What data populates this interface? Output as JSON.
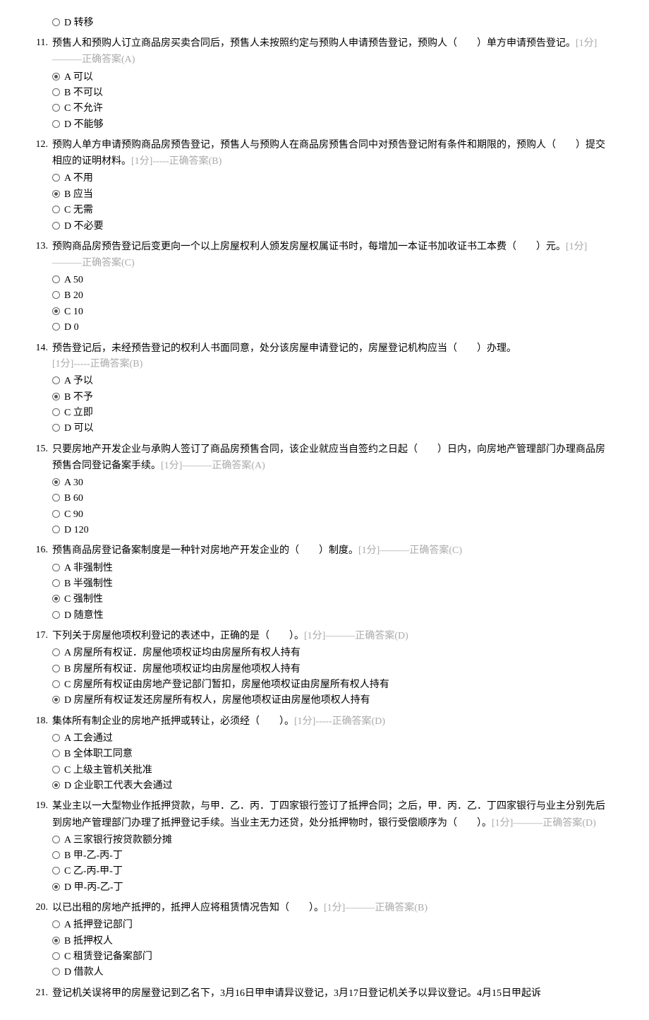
{
  "questions": [
    {
      "num": "",
      "text": "",
      "meta": "",
      "options": [
        {
          "label": "D 转移",
          "selected": false
        }
      ]
    },
    {
      "num": "11.",
      "text": "预售人和预购人订立商品房买卖合同后，预售人未按照约定与预购人申请预告登记，预购人（　　）单方申请预告登记。",
      "meta": "[1分]———正确答案(A)",
      "options": [
        {
          "label": "A 可以",
          "selected": true
        },
        {
          "label": "B 不可以",
          "selected": false
        },
        {
          "label": "C 不允许",
          "selected": false
        },
        {
          "label": "D 不能够",
          "selected": false
        }
      ]
    },
    {
      "num": "12.",
      "text": "预购人单方申请预购商品房预告登记，预售人与预购人在商品房预售合同中对预告登记附有条件和期限的，预购人（　　）提交相应的证明材料。",
      "meta": "[1分]-----正确答案(B)",
      "options": [
        {
          "label": "A 不用",
          "selected": false
        },
        {
          "label": "B 应当",
          "selected": true
        },
        {
          "label": "C 无需",
          "selected": false
        },
        {
          "label": "D 不必要",
          "selected": false
        }
      ]
    },
    {
      "num": "13.",
      "text": "预购商品房预告登记后变更向一个以上房屋权利人颁发房屋权属证书时，每增加一本证书加收证书工本费（　　）元。",
      "meta": "[1分]———正确答案(C)",
      "options": [
        {
          "label": "A 50",
          "selected": false
        },
        {
          "label": "B 20",
          "selected": false
        },
        {
          "label": "C 10",
          "selected": true
        },
        {
          "label": "D 0",
          "selected": false
        }
      ]
    },
    {
      "num": "14.",
      "text": "预告登记后，未经预告登记的权利人书面同意，处分该房屋申请登记的，房屋登记机构应当（　　）办理。",
      "meta": "[1分]-----正确答案(B)",
      "newlineMeta": true,
      "options": [
        {
          "label": "A 予以",
          "selected": false
        },
        {
          "label": "B 不予",
          "selected": true
        },
        {
          "label": "C 立即",
          "selected": false
        },
        {
          "label": "D 可以",
          "selected": false
        }
      ]
    },
    {
      "num": "15.",
      "text": "只要房地产开发企业与承购人签订了商品房预售合同，该企业就应当自签约之日起（　　）日内，向房地产管理部门办理商品房预售合同登记备案手续。",
      "meta": "[1分]———正确答案(A)",
      "options": [
        {
          "label": "A 30",
          "selected": true
        },
        {
          "label": "B 60",
          "selected": false
        },
        {
          "label": "C 90",
          "selected": false
        },
        {
          "label": "D 120",
          "selected": false
        }
      ]
    },
    {
      "num": "16.",
      "text": "预售商品房登记备案制度是一种针对房地产开发企业的（　　）制度。",
      "meta": "[1分]———正确答案(C)",
      "options": [
        {
          "label": "A 非强制性",
          "selected": false
        },
        {
          "label": "B 半强制性",
          "selected": false
        },
        {
          "label": "C 强制性",
          "selected": true
        },
        {
          "label": "D 随意性",
          "selected": false
        }
      ]
    },
    {
      "num": "17.",
      "text": "下列关于房屋他项权利登记的表述中，正确的是（　　）。",
      "meta": "[1分]———正确答案(D)",
      "options": [
        {
          "label": "A 房屋所有权证．房屋他项权证均由房屋所有权人持有",
          "selected": false
        },
        {
          "label": "B 房屋所有权证．房屋他项权证均由房屋他项权人持有",
          "selected": false
        },
        {
          "label": "C 房屋所有权证由房地产登记部门暂扣，房屋他项权证由房屋所有权人持有",
          "selected": false
        },
        {
          "label": "D 房屋所有权证发还房屋所有权人，房屋他项权证由房屋他项权人持有",
          "selected": true
        }
      ]
    },
    {
      "num": "18.",
      "text": "集体所有制企业的房地产抵押或转让，必须经（　　）。",
      "meta": "[1分]-----正确答案(D)",
      "options": [
        {
          "label": "A 工会通过",
          "selected": false
        },
        {
          "label": "B 全体职工同意",
          "selected": false
        },
        {
          "label": "C 上级主管机关批准",
          "selected": false
        },
        {
          "label": "D 企业职工代表大会通过",
          "selected": true
        }
      ]
    },
    {
      "num": "19.",
      "text": "某业主以一大型物业作抵押贷款，与甲．乙．丙．丁四家银行签订了抵押合同；之后，甲．丙．乙．丁四家银行与业主分别先后到房地产管理部门办理了抵押登记手续。当业主无力还贷，处分抵押物时，银行受偿顺序为（　　）。",
      "meta": "[1分]———正确答案(D)",
      "options": [
        {
          "label": "A 三家银行按贷款额分摊",
          "selected": false
        },
        {
          "label": "B 甲-乙-丙-丁",
          "selected": false
        },
        {
          "label": "C 乙-丙-甲-丁",
          "selected": false
        },
        {
          "label": "D 甲-丙-乙-丁",
          "selected": true
        }
      ]
    },
    {
      "num": "20.",
      "text": "以已出租的房地产抵押的，抵押人应将租赁情况告知（　　）。",
      "meta": "[1分]———正确答案(B)",
      "options": [
        {
          "label": "A 抵押登记部门",
          "selected": false
        },
        {
          "label": "B 抵押权人",
          "selected": true
        },
        {
          "label": "C 租赁登记备案部门",
          "selected": false
        },
        {
          "label": "D 借款人",
          "selected": false
        }
      ]
    },
    {
      "num": "21.",
      "text": "登记机关误将甲的房屋登记到乙名下，3月16日甲申请异议登记，3月17日登记机关予以异议登记。4月15日甲起诉",
      "meta": "",
      "options": []
    }
  ]
}
